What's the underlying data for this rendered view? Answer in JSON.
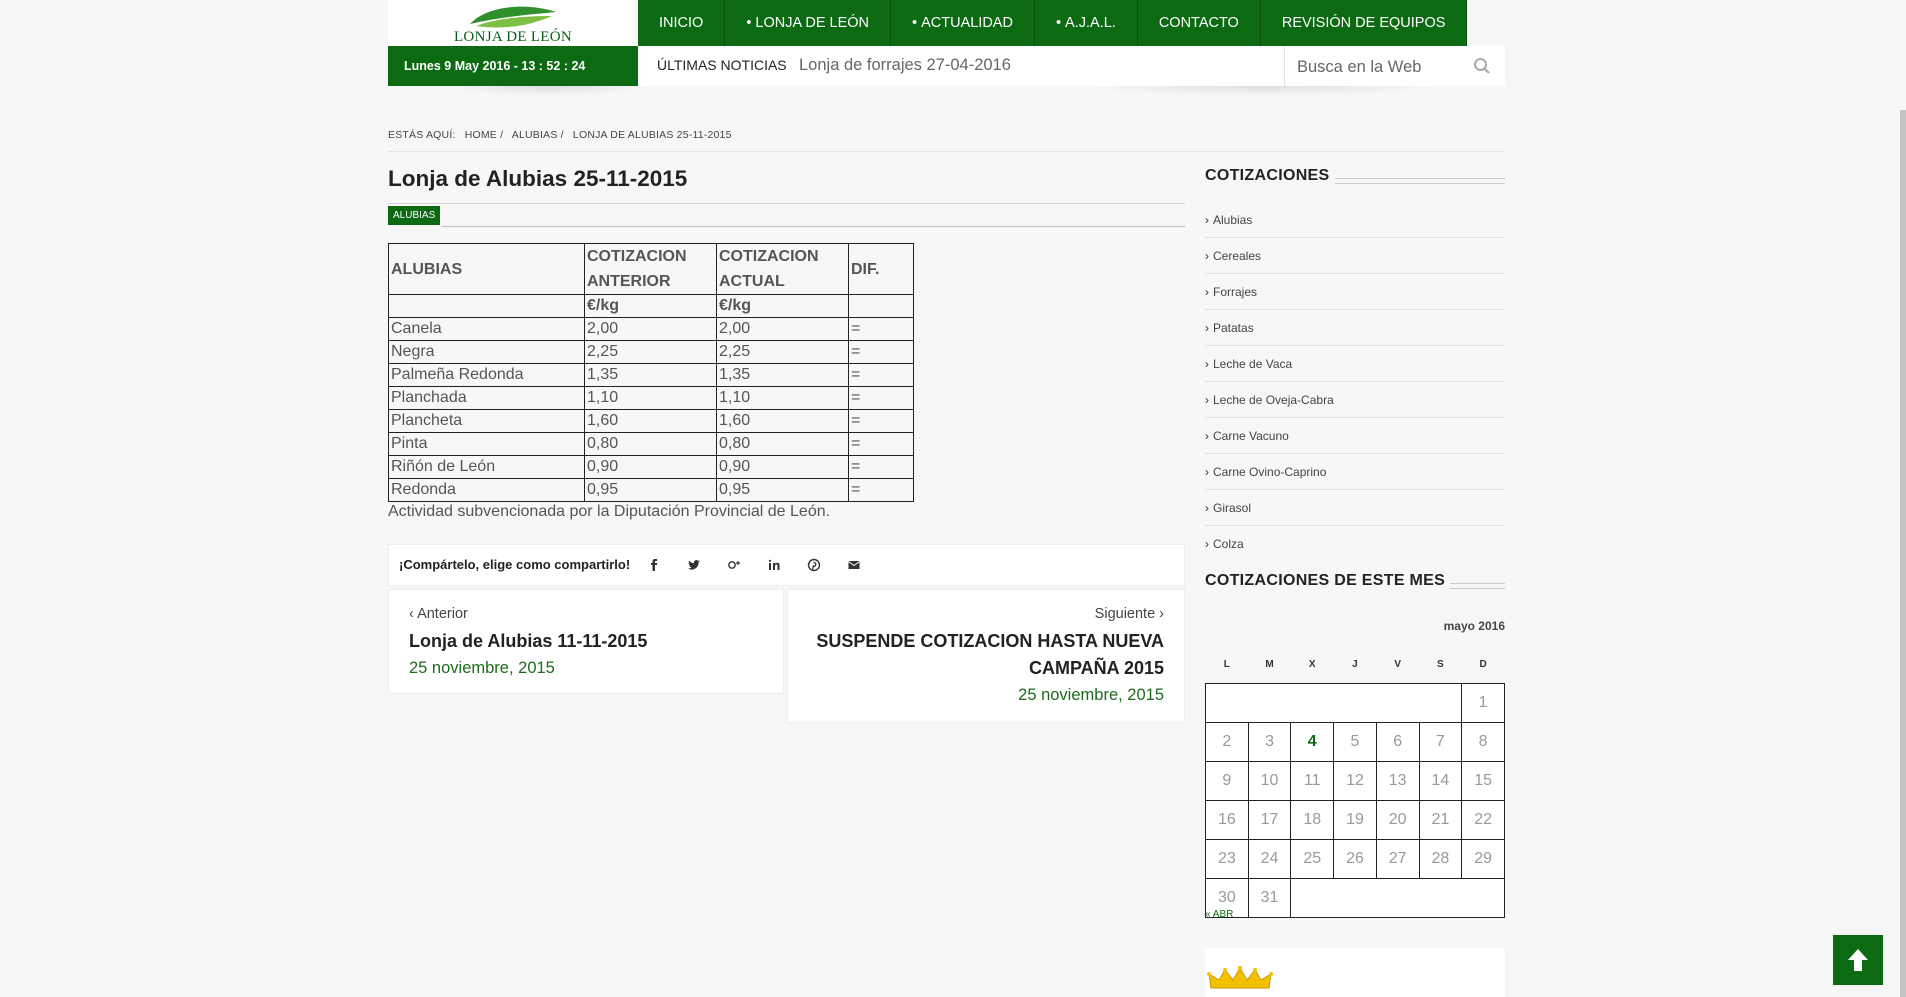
{
  "logo": {
    "text": "LONJA DE LEÓN"
  },
  "nav": {
    "items": [
      {
        "label": "INICIO",
        "dot": ""
      },
      {
        "label": "LONJA DE LEÓN",
        "dot": "•"
      },
      {
        "label": "ACTUALIDAD",
        "dot": "•"
      },
      {
        "label": "A.J.A.L.",
        "dot": "•"
      },
      {
        "label": "CONTACTO",
        "dot": ""
      },
      {
        "label": "REVISIÓN DE EQUIPOS",
        "dot": ""
      }
    ]
  },
  "datebar": {
    "text": "Lunes 9 May 2016 - 13 : 52 : 24"
  },
  "ticker": {
    "label": "ÚLTIMAS NOTICIAS",
    "text": "Lonja de forrajes 27-04-2016"
  },
  "search": {
    "placeholder": "Busca en la Web"
  },
  "breadcrumb": {
    "prefix": "ESTÁS AQUÍ:",
    "home": "HOME /",
    "cat": "ALUBIAS /",
    "current": "LONJA DE ALUBIAS 25-11-2015"
  },
  "post": {
    "title": "Lonja de Alubias 25-11-2015",
    "category": "ALUBIAS",
    "table": {
      "headers": [
        "ALUBIAS",
        "COTIZACION ANTERIOR",
        "COTIZACION ACTUAL",
        "DIF."
      ],
      "units": [
        "",
        "€/kg",
        "€/kg",
        ""
      ],
      "rows": [
        [
          "Canela",
          "2,00",
          "2,00",
          "="
        ],
        [
          "Negra",
          "2,25",
          "2,25",
          "="
        ],
        [
          "Palmeña Redonda",
          "1,35",
          "1,35",
          "="
        ],
        [
          "Planchada",
          "1,10",
          "1,10",
          "="
        ],
        [
          "Plancheta",
          "1,60",
          "1,60",
          "="
        ],
        [
          "Pinta",
          "0,80",
          "0,80",
          "="
        ],
        [
          "Riñón de León",
          "0,90",
          "0,90",
          "="
        ],
        [
          "Redonda",
          "0,95",
          "0,95",
          "="
        ]
      ]
    },
    "note": "Actividad subvencionada por la Diputación Provincial de León.",
    "share_label": "¡Compártelo, elige como compartirlo!"
  },
  "prev": {
    "label": "Anterior",
    "title": "Lonja de Alubias 11-11-2015",
    "date": "25 noviembre, 2015"
  },
  "next": {
    "label": "Siguiente",
    "title_line1": "SUSPENDE COTIZACION HASTA NUEVA",
    "title_line2": "CAMPAÑA 2015",
    "date": "25 noviembre, 2015"
  },
  "sidebar": {
    "cotizaciones_title": "COTIZACIONES",
    "items": [
      "Alubias",
      "Cereales",
      "Forrajes",
      "Patatas",
      "Leche de Vaca",
      "Leche de Oveja-Cabra",
      "Carne Vacuno",
      "Carne Ovino-Caprino",
      "Girasol",
      "Colza"
    ],
    "month_title": "COTIZACIONES DE ESTE MES"
  },
  "calendar": {
    "caption": "mayo 2016",
    "weekdays": [
      "L",
      "M",
      "X",
      "J",
      "V",
      "S",
      "D"
    ],
    "weeks": [
      [
        "",
        "",
        "",
        "",
        "",
        "",
        "1"
      ],
      [
        "2",
        "3",
        "4",
        "5",
        "6",
        "7",
        "8"
      ],
      [
        "9",
        "10",
        "11",
        "12",
        "13",
        "14",
        "15"
      ],
      [
        "16",
        "17",
        "18",
        "19",
        "20",
        "21",
        "22"
      ],
      [
        "23",
        "24",
        "25",
        "26",
        "27",
        "28",
        "29"
      ],
      [
        "30",
        "31",
        "",
        "",
        "",
        "",
        ""
      ]
    ],
    "today": "4",
    "prev_link": "« ABR"
  },
  "colors": {
    "brand_green": "#0b6a12",
    "date_green": "#1d6b1d"
  },
  "icons": {
    "search": "search-icon",
    "back_to_top": "arrow-up-icon"
  }
}
